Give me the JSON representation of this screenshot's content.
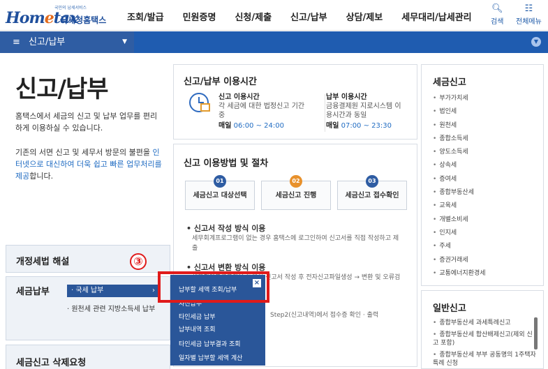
{
  "header": {
    "logo_tagline": "국민의 납세서비스",
    "logo_word_a": "Hom",
    "logo_word_e": "e",
    "logo_word_b": "tax",
    "logo_korean": "국세청홈택스",
    "nav": [
      "조회/발급",
      "민원증명",
      "신청/제출",
      "신고/납부",
      "상담/제보",
      "세무대리/납세관리"
    ],
    "search_label": "검색",
    "allmenu_label": "전체메뉴"
  },
  "breadcrumb": {
    "label": "신고/납부"
  },
  "left": {
    "title": "신고/납부",
    "intro": "홈택스에서 세금의 신고 및 납부 업무를 편리하게 이용하실 수 있습니다.",
    "intro2_a": "기존의 서면 신고 및 세무서 방문의 불편을 ",
    "intro2_blue": "인터넷으로 대신하여 더욱 쉽고 빠른 업무처리를 제공",
    "intro2_b": "합니다.",
    "box1_title": "개정세법 해설",
    "box2_title": "세금납부",
    "box2_selected": "· 국세 납부",
    "box2_item": "· 원천세 관련 지방소득세 납부",
    "box3_title": "세금신고 삭제요청"
  },
  "time_panel": {
    "title": "신고/납부 이용시간",
    "col1_title": "신고 이용시간",
    "col1_desc": "각 세금에 대한 법정신고 기간 중",
    "col1_label": "매일",
    "col1_time": "06:00 ~ 24:00",
    "col2_title": "납부 이용시간",
    "col2_desc": "금융결제원 지로시스템 이용시간과 동일",
    "col2_label": "매일",
    "col2_time": "07:00 ~ 23:30"
  },
  "proc_panel": {
    "title": "신고 이용방법 및 절차",
    "steps": [
      {
        "num": "01",
        "label": "세금신고 대상선택",
        "color": "#2f5da3"
      },
      {
        "num": "02",
        "label": "세금신고 진행",
        "color": "#e8912c"
      },
      {
        "num": "03",
        "label": "세금신고 접수확인",
        "color": "#2f5da3"
      }
    ],
    "sec1_title": "• 신고서 작성 방식 이용",
    "sec1_text": "세무회계프로그램이 없는 경우 홈택스에 로그인하여 신고서를 직접 작성하고 제출",
    "sec2_title": "• 신고서 변환 방식 이용",
    "sec2_text": "세무회계프로그램을 통해서 신고서 작성 후 전자신고파일생성 → 변환 및 오류검증(형식 · 내용검증) 후 제출",
    "sec3_text": "Step2(신고내역)에서 접수증 확인 · 출력"
  },
  "right": {
    "title": "세금신고",
    "items": [
      "부가가치세",
      "법인세",
      "원천세",
      "종합소득세",
      "양도소득세",
      "상속세",
      "증여세",
      "종합부동산세",
      "교육세",
      "개별소비세",
      "인지세",
      "주세",
      "증권거래세",
      "교통에너지환경세"
    ],
    "title2": "일반신고",
    "items2": [
      "종합부동산세 과세특례신고",
      "종합부동산세 합산배제신고(제외 신고 포함)",
      "종합부동산세 부부 공동명의 1주택자 특례 신청"
    ]
  },
  "dropdown": {
    "items": [
      "납부할 세액 조회/납부",
      "자진납부",
      "타인세금 납부",
      "납부내역 조회",
      "타인세금 납부결과 조회",
      "일자별 납부할 세액 계산"
    ],
    "close": "×"
  },
  "annotation": {
    "marker": "③"
  }
}
